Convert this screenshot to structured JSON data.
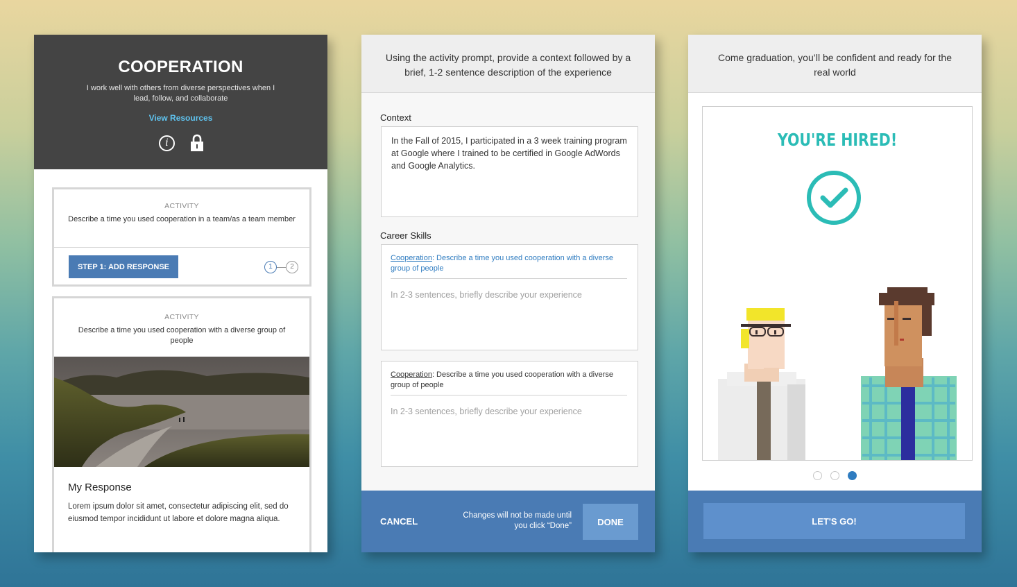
{
  "panel1": {
    "title": "COOPERATION",
    "description": "I work well with others from diverse perspectives when I lead, follow, and collaborate",
    "view_resources": "View Resources",
    "icons": [
      "info-icon",
      "lock-icon"
    ],
    "activity1": {
      "label": "ACTIVITY",
      "text": "Describe a time you used cooperation in a team/as a team member",
      "button": "STEP 1: ADD RESPONSE",
      "steps": [
        "1",
        "2"
      ],
      "current_step": 1
    },
    "activity2": {
      "label": "ACTIVITY",
      "text": "Describe a time you used cooperation with a diverse group of people",
      "response_title": "My Response",
      "response_text": "Lorem ipsum dolor sit amet, consectetur adipiscing elit, sed do eiusmod tempor incididunt ut labore et dolore magna aliqua."
    }
  },
  "panel2": {
    "prompt": "Using the activity prompt, provide a context followed by a brief, 1-2 sentence description of the experience",
    "context_label": "Context",
    "context_value": "In the Fall of 2015, I participated in a 3 week training program at Google where I trained to be certified in Google AdWords and Google Analytics.",
    "skills_label": "Career Skills",
    "skills": [
      {
        "skill": "Cooperation",
        "prompt": ": Describe a time you used cooperation with a diverse group of people",
        "placeholder": "In 2-3 sentences, briefly describe your experience"
      },
      {
        "skill": "Cooperation",
        "prompt": ": Describe a time you used cooperation with a diverse group of people",
        "placeholder": "In 2-3 sentences, briefly describe your experience"
      }
    ],
    "cancel": "CANCEL",
    "note": "Changes will not be made until you click “Done”",
    "done": "DONE"
  },
  "panel3": {
    "text": "Come graduation, you’ll be confident and ready for the real world",
    "hired": "YOU'RE HIRED!",
    "page_dots": 3,
    "active_dot": 3,
    "button": "LET'S GO!"
  },
  "colors": {
    "header_dark": "#444444",
    "link_blue": "#5fc3ef",
    "primary_blue": "#4a7bb4",
    "accent_teal": "#2bbcb6",
    "skill_link": "#2f7cc0"
  }
}
